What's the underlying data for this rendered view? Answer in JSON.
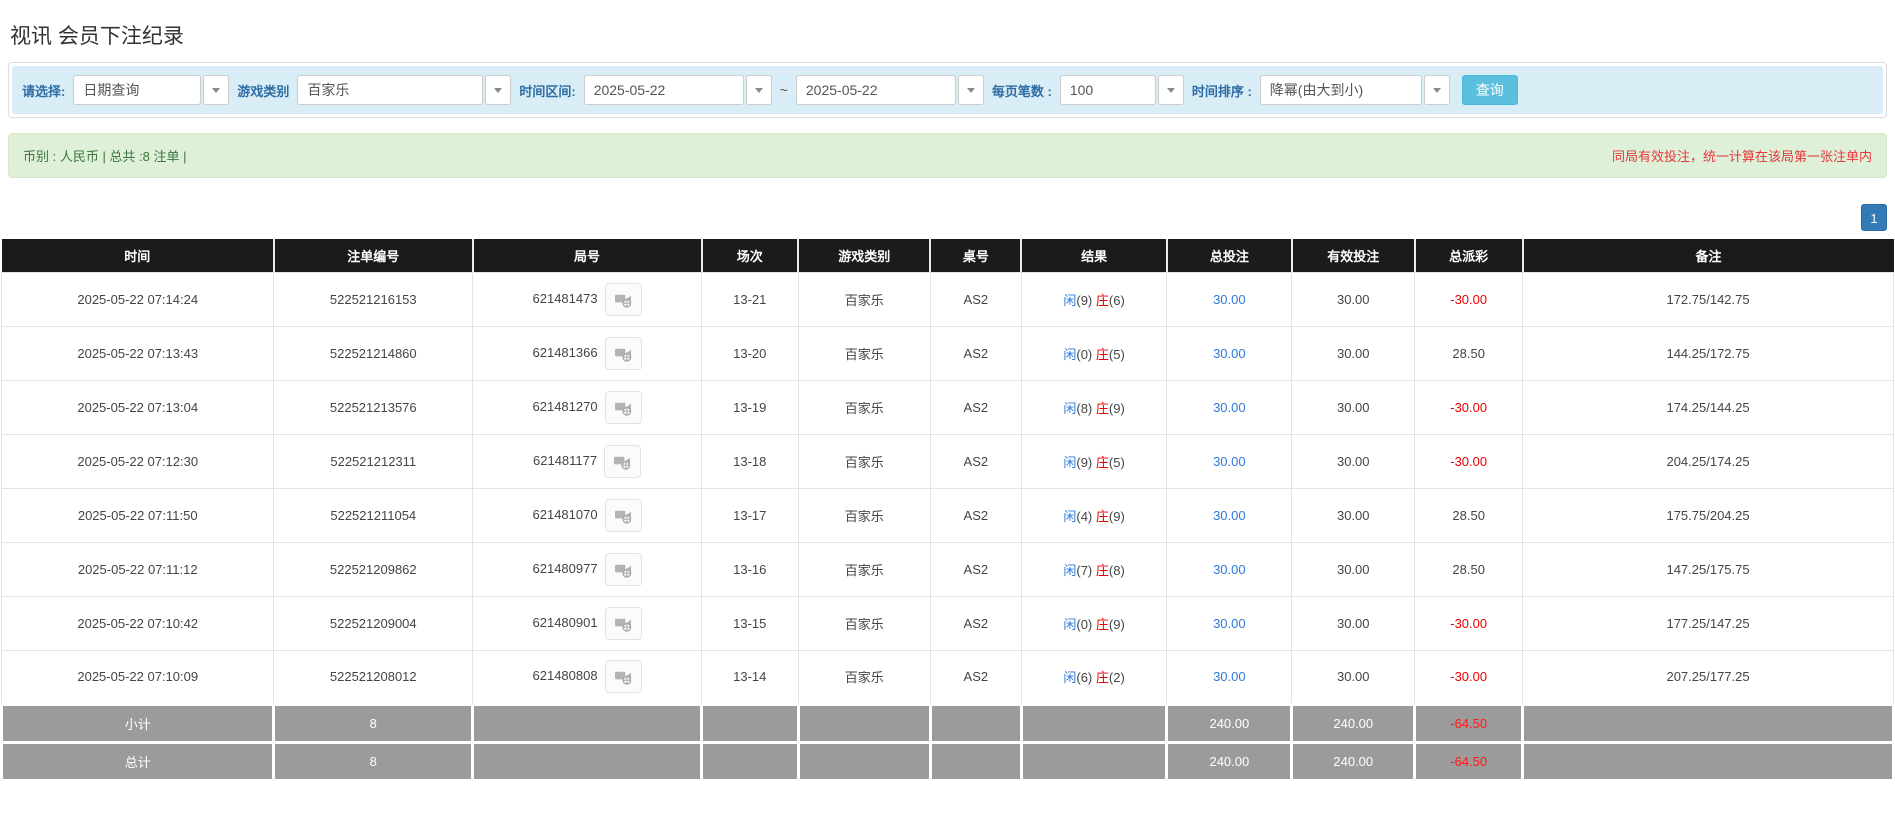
{
  "page": {
    "title": "视讯 会员下注纪录"
  },
  "filters": {
    "select_label": "请选择:",
    "select_value": "日期查询",
    "game_label": "游戏类别",
    "game_value": "百家乐",
    "range_label": "时间区间:",
    "date_from": "2025-05-22",
    "range_separator": "~",
    "date_to": "2025-05-22",
    "page_size_label": "每页笔数 :",
    "page_size_value": "100",
    "sort_label": "时间排序 :",
    "sort_value": "降幂(由大到小)",
    "search_button": "查询"
  },
  "summary": {
    "left": "币别 : 人民币 | 总共 :8 注单 |",
    "right_note": "同局有效投注，统一计算在该局第一张注单内"
  },
  "pagination": {
    "current_page": "1"
  },
  "table": {
    "headers": [
      "时间",
      "注单编号",
      "局号",
      "场次",
      "游戏类别",
      "桌号",
      "结果",
      "总投注",
      "有效投注",
      "总派彩",
      "备注"
    ],
    "result_labels": {
      "player": "闲",
      "banker": "庄"
    },
    "rows": [
      {
        "time": "2025-05-22 07:14:24",
        "bet_id": "522521216153",
        "round_id": "621481473",
        "session": "13-21",
        "game": "百家乐",
        "table_no": "AS2",
        "player": "9",
        "banker": "6",
        "total_bet": "30.00",
        "valid_bet": "30.00",
        "payout": "-30.00",
        "remark": "172.75/142.75"
      },
      {
        "time": "2025-05-22 07:13:43",
        "bet_id": "522521214860",
        "round_id": "621481366",
        "session": "13-20",
        "game": "百家乐",
        "table_no": "AS2",
        "player": "0",
        "banker": "5",
        "total_bet": "30.00",
        "valid_bet": "30.00",
        "payout": "28.50",
        "remark": "144.25/172.75"
      },
      {
        "time": "2025-05-22 07:13:04",
        "bet_id": "522521213576",
        "round_id": "621481270",
        "session": "13-19",
        "game": "百家乐",
        "table_no": "AS2",
        "player": "8",
        "banker": "9",
        "total_bet": "30.00",
        "valid_bet": "30.00",
        "payout": "-30.00",
        "remark": "174.25/144.25"
      },
      {
        "time": "2025-05-22 07:12:30",
        "bet_id": "522521212311",
        "round_id": "621481177",
        "session": "13-18",
        "game": "百家乐",
        "table_no": "AS2",
        "player": "9",
        "banker": "5",
        "total_bet": "30.00",
        "valid_bet": "30.00",
        "payout": "-30.00",
        "remark": "204.25/174.25"
      },
      {
        "time": "2025-05-22 07:11:50",
        "bet_id": "522521211054",
        "round_id": "621481070",
        "session": "13-17",
        "game": "百家乐",
        "table_no": "AS2",
        "player": "4",
        "banker": "9",
        "total_bet": "30.00",
        "valid_bet": "30.00",
        "payout": "28.50",
        "remark": "175.75/204.25"
      },
      {
        "time": "2025-05-22 07:11:12",
        "bet_id": "522521209862",
        "round_id": "621480977",
        "session": "13-16",
        "game": "百家乐",
        "table_no": "AS2",
        "player": "7",
        "banker": "8",
        "total_bet": "30.00",
        "valid_bet": "30.00",
        "payout": "28.50",
        "remark": "147.25/175.75"
      },
      {
        "time": "2025-05-22 07:10:42",
        "bet_id": "522521209004",
        "round_id": "621480901",
        "session": "13-15",
        "game": "百家乐",
        "table_no": "AS2",
        "player": "0",
        "banker": "9",
        "total_bet": "30.00",
        "valid_bet": "30.00",
        "payout": "-30.00",
        "remark": "177.25/147.25"
      },
      {
        "time": "2025-05-22 07:10:09",
        "bet_id": "522521208012",
        "round_id": "621480808",
        "session": "13-14",
        "game": "百家乐",
        "table_no": "AS2",
        "player": "6",
        "banker": "2",
        "total_bet": "30.00",
        "valid_bet": "30.00",
        "payout": "-30.00",
        "remark": "207.25/177.25"
      }
    ],
    "footer": [
      {
        "label": "小计",
        "count": "8",
        "total_bet": "240.00",
        "valid_bet": "240.00",
        "payout": "-64.50"
      },
      {
        "label": "总计",
        "count": "8",
        "total_bet": "240.00",
        "valid_bet": "240.00",
        "payout": "-64.50"
      }
    ]
  },
  "colors": {
    "filter_bar_bg": "#d9edf7",
    "filter_label": "#2e6da4",
    "search_button_bg": "#5bc0de",
    "summary_bg": "#dff0d8",
    "summary_text": "#3c763d",
    "note_red": "#e4393c",
    "header_bg": "#1b1b1b",
    "link_blue": "#2f7bd9",
    "negative_red": "#ee0000",
    "footer_bg": "#9b9b9b",
    "pagination_blue": "#337ab7"
  },
  "icons": {
    "dropdown_caret": "caret-down",
    "round_video": "video-replay"
  }
}
